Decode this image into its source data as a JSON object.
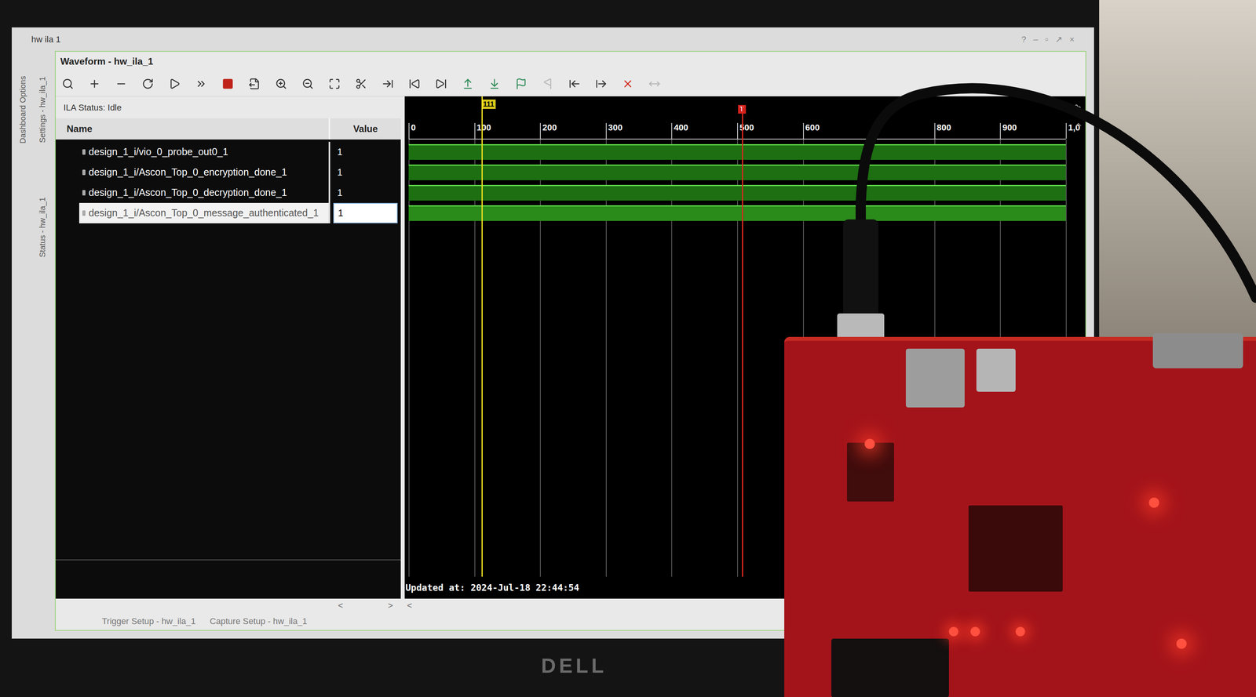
{
  "window": {
    "title": "hw ila 1",
    "controls": [
      "?",
      "–",
      "▫",
      "↗",
      "×"
    ]
  },
  "side_tabs": [
    {
      "labels": [
        "Dashboard Options"
      ]
    },
    {
      "labels": [
        "Settings - hw_ila_1",
        "Status - hw_ila_1"
      ]
    }
  ],
  "panel": {
    "title": "Waveform - hw_ila_1"
  },
  "toolbar": [
    {
      "disabled": false
    },
    {
      "disabled": false
    },
    {
      "disabled": false
    },
    {
      "disabled": false
    },
    {
      "disabled": false
    },
    {
      "disabled": false
    },
    {
      "disabled": false
    },
    {
      "disabled": false
    },
    {
      "disabled": false
    },
    {
      "disabled": false
    },
    {
      "disabled": false
    },
    {
      "disabled": false
    },
    {
      "disabled": false
    },
    {
      "disabled": false
    },
    {
      "disabled": false
    },
    {
      "disabled": false
    },
    {
      "disabled": false
    },
    {
      "disabled": false
    },
    {
      "disabled": true
    },
    {
      "disabled": false
    },
    {
      "disabled": false
    },
    {
      "disabled": false
    },
    {
      "disabled": true
    }
  ],
  "ila_status": "ILA Status: Idle",
  "columns": [
    "Name",
    "Value"
  ],
  "signals": [
    {
      "name": "design_1_i/vio_0_probe_out0_1",
      "value": "1",
      "high": true,
      "selected": false
    },
    {
      "name": "design_1_i/Ascon_Top_0_encryption_done_1",
      "value": "1",
      "high": true,
      "selected": false
    },
    {
      "name": "design_1_i/Ascon_Top_0_decryption_done_1",
      "value": "1",
      "high": true,
      "selected": false
    },
    {
      "name": "design_1_i/Ascon_Top_0_message_authenticated_1",
      "value": "1",
      "high": true,
      "selected": true
    }
  ],
  "ruler": {
    "ticks": [
      {
        "label": "0",
        "value": 0
      },
      {
        "label": "100",
        "value": 100
      },
      {
        "label": "200",
        "value": 200
      },
      {
        "label": "300",
        "value": 300
      },
      {
        "label": "400",
        "value": 400
      },
      {
        "label": "500",
        "value": 500
      },
      {
        "label": "600",
        "value": 600
      },
      {
        "label": "800",
        "value": 800
      },
      {
        "label": "900",
        "value": 900
      },
      {
        "label": "1,0",
        "value": 1000
      }
    ],
    "max": 1000
  },
  "cursor": {
    "label": "111",
    "value": 111
  },
  "trigger": {
    "label": "T",
    "value": 507
  },
  "updated_at": "Updated at: 2024-Jul-18 22:44:54",
  "scroll_glyphs": {
    "left": "<",
    "right": ">"
  },
  "bottom_tabs": [
    {
      "label": "Trigger Setup - hw_ila_1",
      "selected": false
    },
    {
      "label": "Capture Setup - hw_ila_1",
      "selected": false
    }
  ],
  "bezel_logo": "DELL"
}
